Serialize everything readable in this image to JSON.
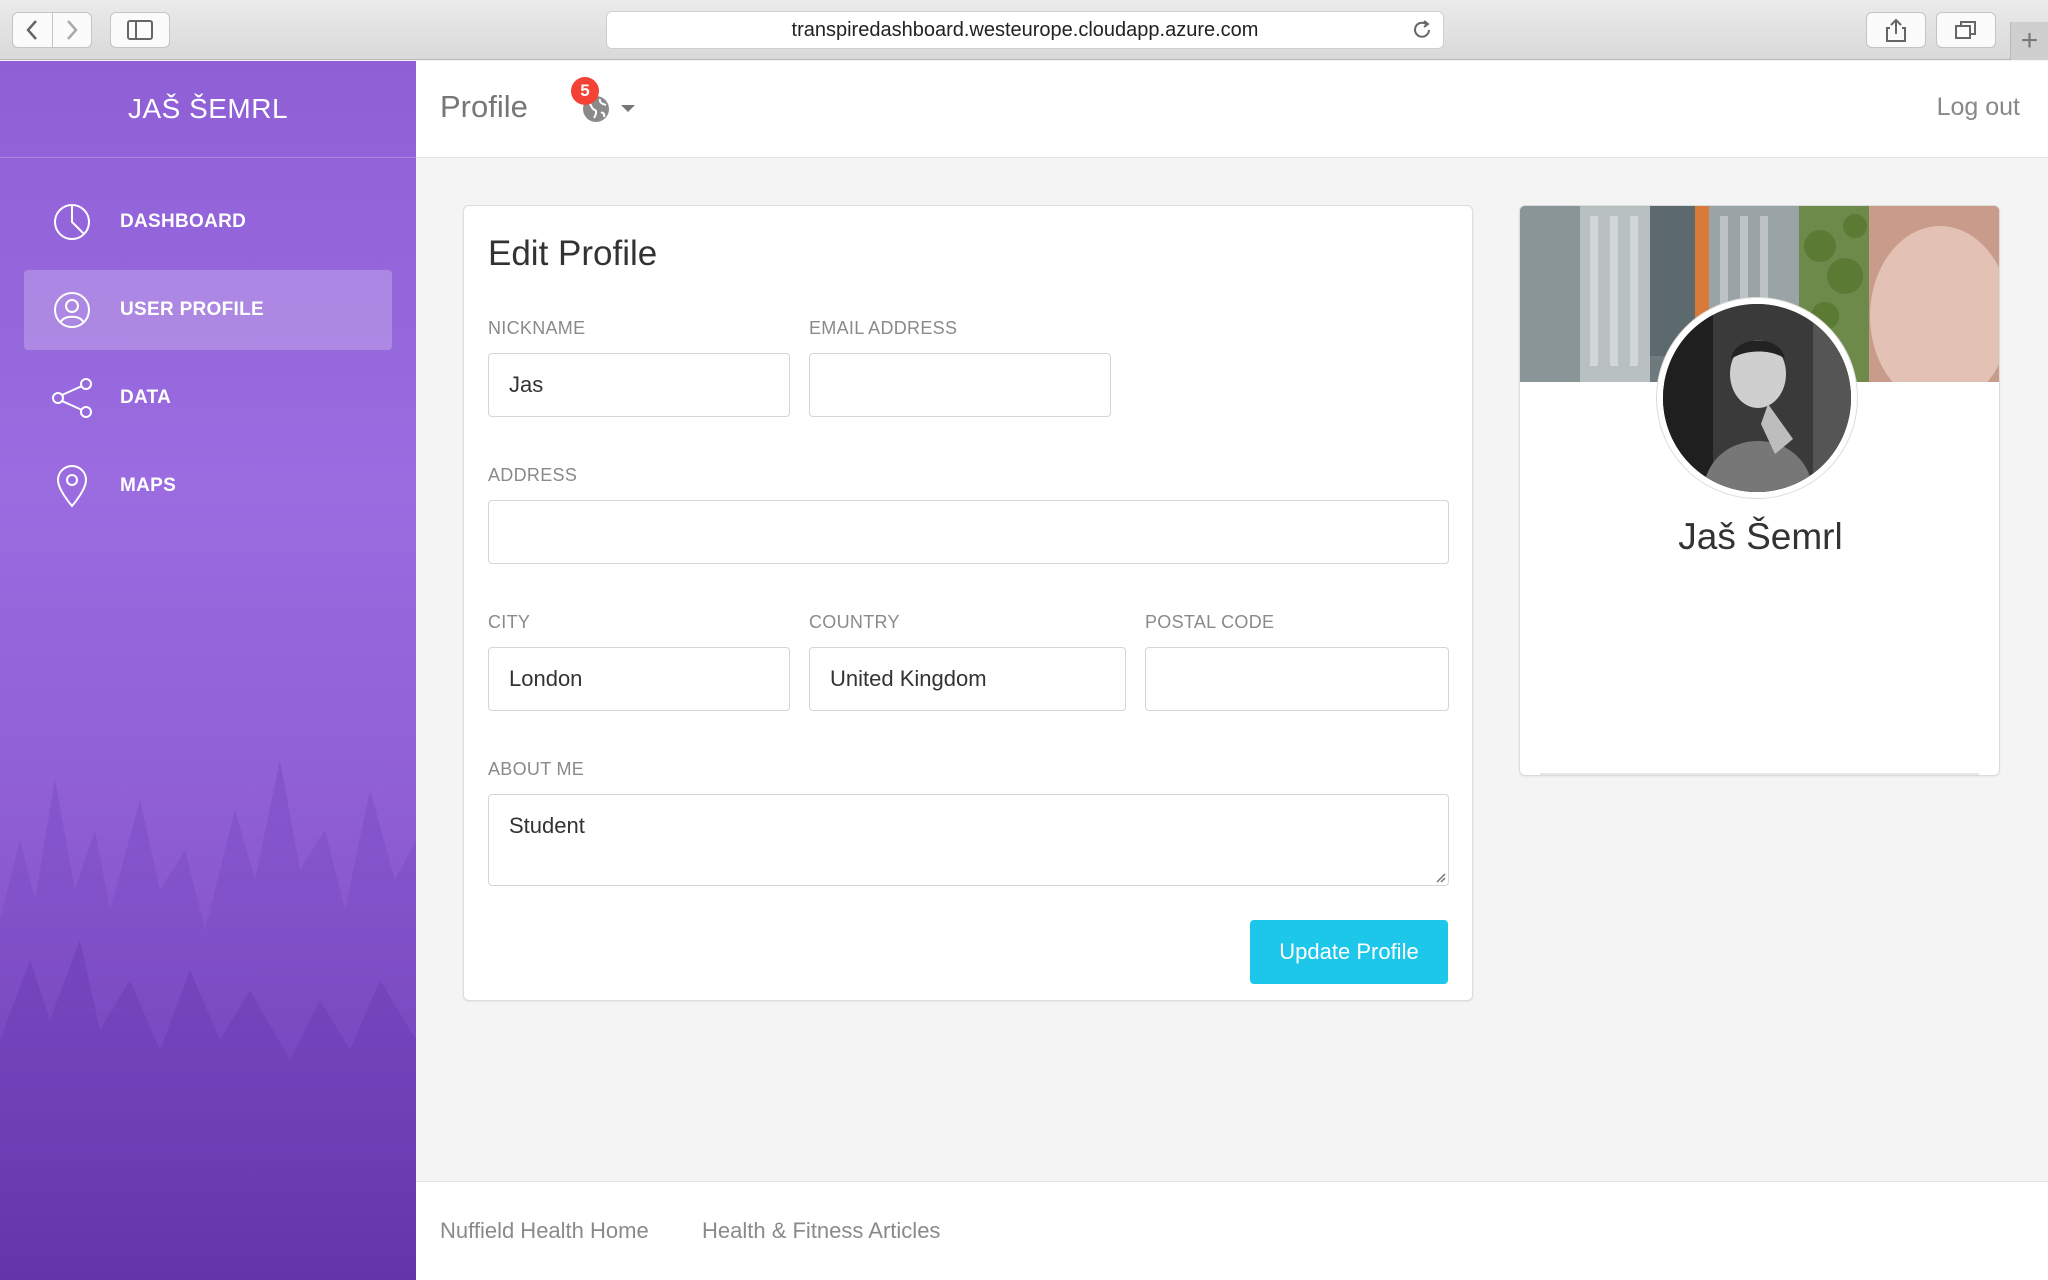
{
  "browser": {
    "url": "transpiredashboard.westeurope.cloudapp.azure.com"
  },
  "sidebar": {
    "brand": "JAŠ ŠEMRL",
    "items": [
      {
        "label": "DASHBOARD",
        "icon": "pie-chart-icon",
        "active": false
      },
      {
        "label": "USER PROFILE",
        "icon": "user-icon",
        "active": true
      },
      {
        "label": "DATA",
        "icon": "share-icon",
        "active": false
      },
      {
        "label": "MAPS",
        "icon": "map-pin-icon",
        "active": false
      }
    ]
  },
  "header": {
    "title": "Profile",
    "notification_count": "5",
    "logout_label": "Log out"
  },
  "edit_profile": {
    "title": "Edit Profile",
    "nickname_label": "NICKNAME",
    "nickname_value": "Jas",
    "email_label": "EMAIL ADDRESS",
    "email_value": "",
    "address_label": "ADDRESS",
    "address_value": "",
    "city_label": "CITY",
    "city_value": "London",
    "country_label": "COUNTRY",
    "country_value": "United Kingdom",
    "postal_label": "POSTAL CODE",
    "postal_value": "",
    "about_label": "ABOUT ME",
    "about_value": "Student",
    "update_label": "Update Profile"
  },
  "profile_card": {
    "name": "Jaš Šemrl"
  },
  "footer": {
    "links": [
      "Nuffield Health Home",
      "Health & Fitness Articles"
    ]
  },
  "colors": {
    "sidebar": "#9a6ce0",
    "button": "#1dc7ea",
    "badge": "#f44336"
  }
}
